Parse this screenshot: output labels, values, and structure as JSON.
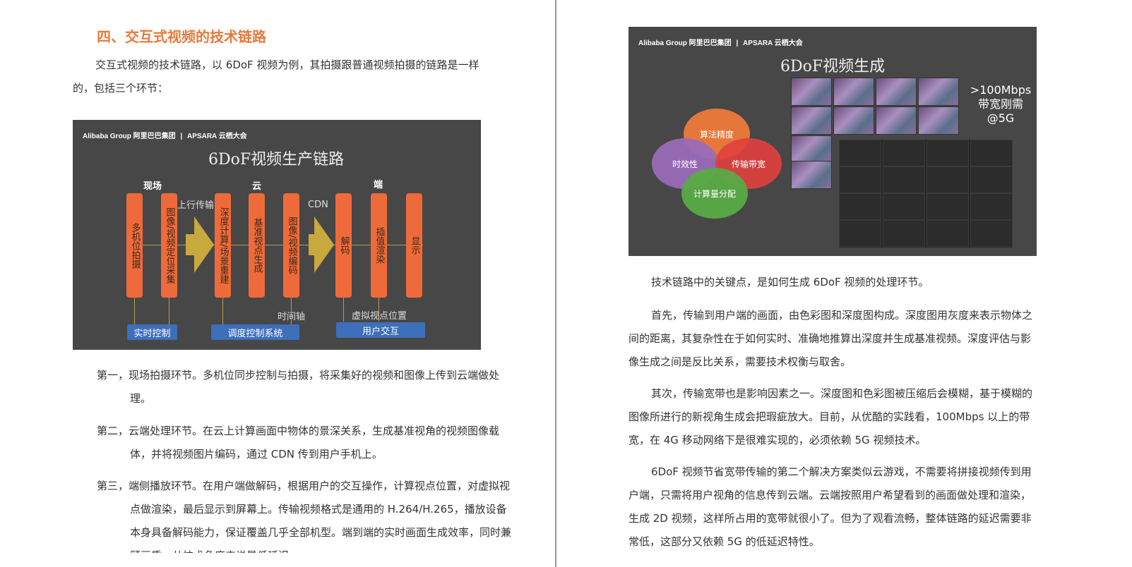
{
  "left": {
    "heading": "四、交互式视频的技术链路",
    "intro": "交互式视频的技术链路，以 6DoF 视频为例，其拍摄跟普通视频拍摄的链路是一样的，包括三个环节：",
    "items": [
      {
        "label": "第一，",
        "text": "现场拍摄环节。多机位同步控制与拍摄，将采集好的视频和图像上传到云端做处理。"
      },
      {
        "label": "第二，",
        "text": "云端处理环节。在云上计算画面中物体的景深关系，生成基准视角的视频图像载体，并将视频图片编码，通过 CDN 传到用户手机上。"
      },
      {
        "label": "第三，",
        "text": "端侧播放环节。在用户端做解码，根据用户的交互操作，计算视点位置，对虚拟视点做渲染，最后显示到屏幕上。传输视频格式是通用的 H.264/H.265，播放设备本身具备解码能力，保证覆盖几乎全部机型。端到端的实时画面生成效率，同时兼顾画质，从技术角度来说是低延迟"
      }
    ]
  },
  "slide1": {
    "logo_left": "Alibaba Group 阿里巴巴集团",
    "logo_right": "APSARA 云栖大会",
    "title": "6DoF视频生产链路",
    "stages": [
      "现场",
      "云",
      "端"
    ],
    "pills": [
      "多机位拍摄",
      "图像/视频定位采集",
      "深度计算/场景重建",
      "基准视点生成",
      "图像/视频编码",
      "解码",
      "插值渲染",
      "显示"
    ],
    "upload_label": "上行传输",
    "cdn_label": "CDN",
    "timeline_label": "时间轴",
    "viewpoint_label": "虚拟视点位置",
    "boxes": [
      "实时控制",
      "调度控制系统",
      "用户交互"
    ]
  },
  "slide2": {
    "logo_left": "Alibaba Group 阿里巴巴集团",
    "logo_right": "APSARA 云栖大会",
    "title": "6DoF视频生成",
    "circles": [
      "算法精度",
      "时效性",
      "传输带宽",
      "计算量分配"
    ],
    "bandwidth": ">100Mbps\n带宽刚需\n@5G",
    "colors": {
      "orange": "#ef7a3a",
      "purple": "#9a6cb8",
      "red": "#e0413f",
      "green": "#5aab46"
    }
  },
  "right": {
    "paragraphs": [
      "技术链路中的关键点，是如何生成 6DoF 视频的处理环节。",
      "首先，传输到用户端的画面，由色彩图和深度图构成。深度图用灰度来表示物体之间的距离，其复杂性在于如何实时、准确地推算出深度并生成基准视频。深度评估与影像生成之间是反比关系，需要技术权衡与取舍。",
      "其次，传输宽带也是影响因素之一。深度图和色彩图被压缩后会模糊，基于模糊的图像所进行的新视角生成会把瑕疵放大。目前，从优酷的实践看，100Mbps 以上的带宽，在 4G 移动网络下是很难实现的，必须依赖 5G 视频技术。",
      "6DoF 视频节省宽带传输的第二个解决方案类似云游戏，不需要将拼接视频传到用户端，只需将用户视角的信息传到云端。云端按照用户希望看到的画面做处理和渲染，生成 2D 视频，这样所占用的宽带就很小了。但为了观看流畅，整体链路的延迟需要非常低，这部分又依赖 5G 的低延迟特性。"
    ]
  }
}
